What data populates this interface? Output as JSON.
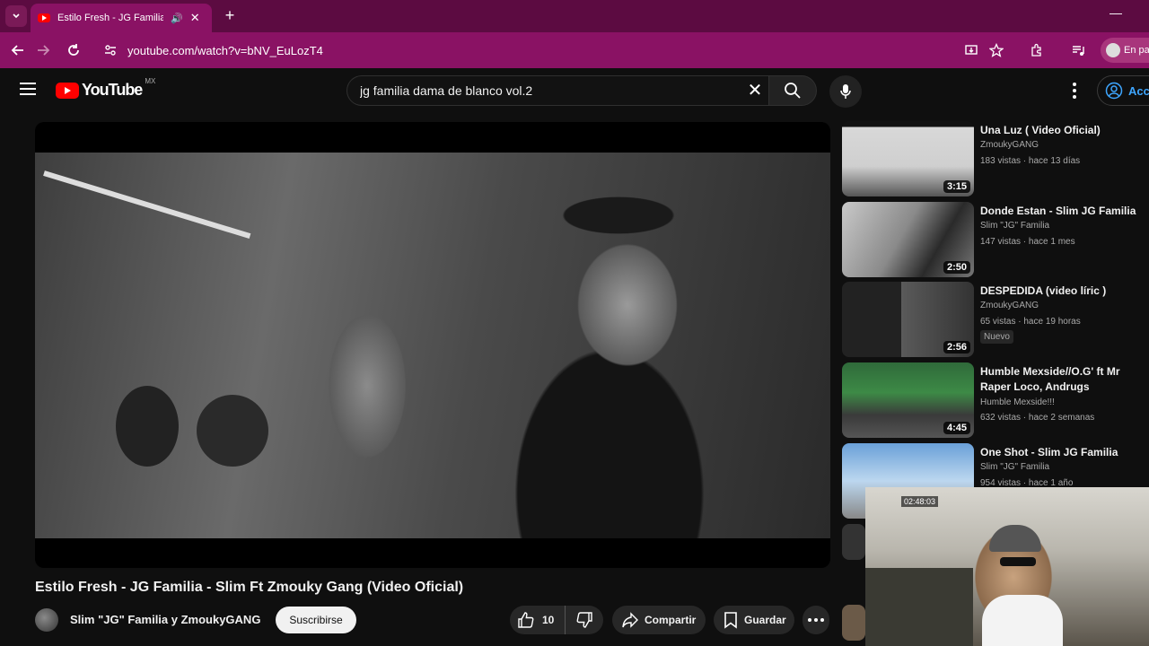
{
  "browser": {
    "tab_title": "Estilo Fresh - JG Familia - Sl",
    "url": "youtube.com/watch?v=bNV_EuLozT4",
    "profile_label": "En pau"
  },
  "masthead": {
    "logo_text": "YouTube",
    "country_code": "MX",
    "search_value": "jg familia dama de blanco vol.2",
    "signin_label": "Acce"
  },
  "video": {
    "title": "Estilo Fresh - JG Familia - Slim Ft Zmouky Gang (Video Oficial)",
    "channel": "Slim \"JG\" Familia y ZmoukyGANG",
    "subscribe_label": "Suscribirse",
    "like_count": "10",
    "share_label": "Compartir",
    "save_label": "Guardar"
  },
  "recommendations": [
    {
      "title": "Una Luz ( Video Oficial)",
      "channel": "ZmoukyGANG",
      "meta": "183 vistas · hace 13 días",
      "duration": "3:15"
    },
    {
      "title": "Donde Estan - Slim JG Familia",
      "channel": "Slim \"JG\" Familia",
      "meta": "147 vistas · hace 1 mes",
      "duration": "2:50"
    },
    {
      "title": "DESPEDIDA (video líric )",
      "channel": "ZmoukyGANG",
      "meta": "65 vistas · hace 19 horas",
      "duration": "2:56",
      "badge": "Nuevo"
    },
    {
      "title": "Humble Mexside//O.G' ft Mr Raper Loco, Andrugs",
      "channel": "Humble Mexside!!!",
      "meta": "632 vistas · hace 2 semanas",
      "duration": "4:45"
    },
    {
      "title": "One Shot - Slim JG Familia",
      "channel": "Slim \"JG\" Familia",
      "meta": "954 vistas · hace 1 año",
      "duration": ""
    }
  ],
  "webcam": {
    "stamp": "02:48:03"
  },
  "colors": {
    "tabstrip": "#5c0b41",
    "toolbar": "#8a1264",
    "yt_red": "#ff0000",
    "background": "#0f0f0f"
  }
}
